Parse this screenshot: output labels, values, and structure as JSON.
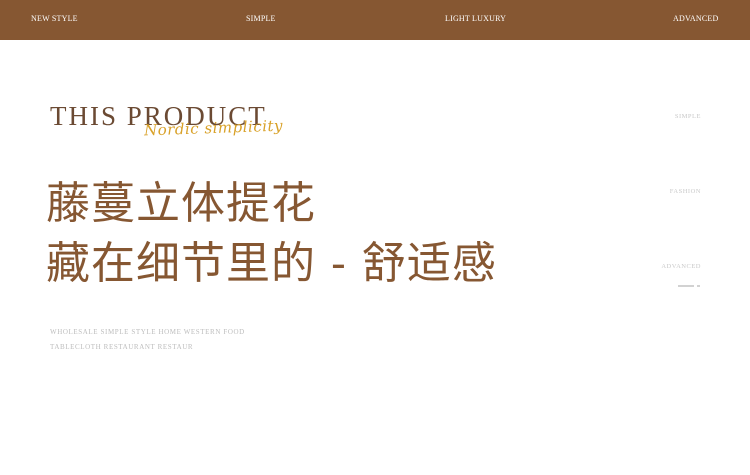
{
  "nav": {
    "items": [
      "NEW STYLE",
      "SIMPLE",
      "LIGHT LUXURY",
      "ADVANCED"
    ]
  },
  "hero": {
    "title": "THIS PRODUCT",
    "script": "Nordic simplicity",
    "headline_line1": "藤蔓立体提花",
    "headline_line2": "藏在细节里的 - 舒适感",
    "desc_line1": "WHOLESALE SIMPLE STYLE HOME WESTERN FOOD",
    "desc_line2": "TABLECLOTH RESTAURANT RESTAUR"
  },
  "side": {
    "items": [
      "SIMPLE",
      "FASHION",
      "ADVANCED"
    ]
  },
  "colors": {
    "brand_brown": "#865732",
    "title_brown": "#6b4a33",
    "script_gold": "#d9a22a",
    "muted_gray": "#bdbdbd"
  }
}
